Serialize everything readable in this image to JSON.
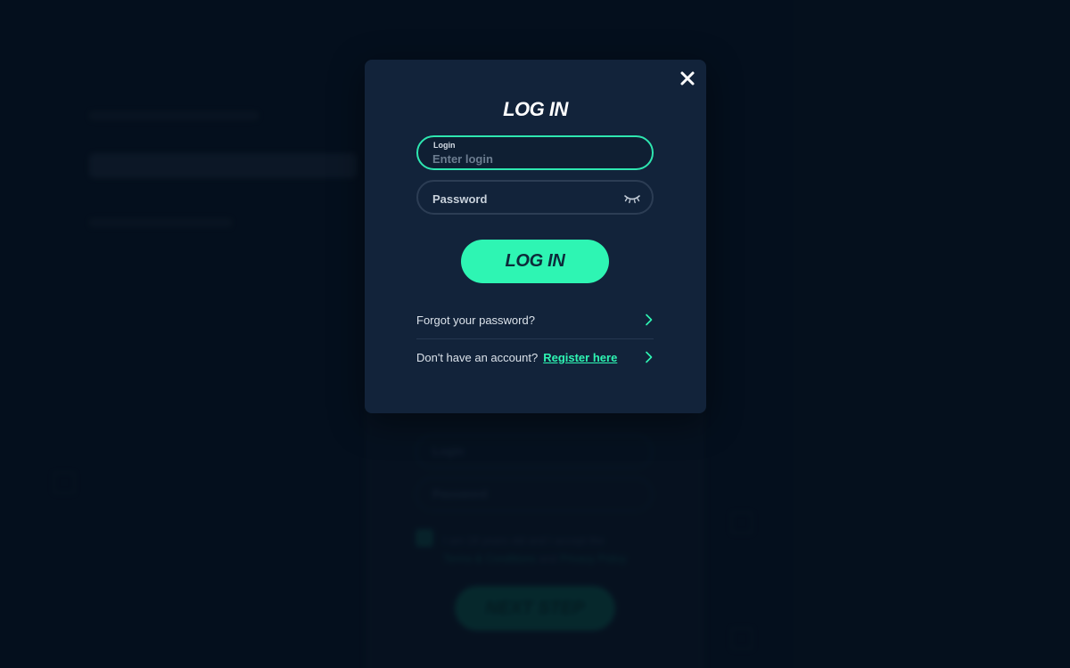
{
  "background": {
    "next_step_label": "NEXT STEP",
    "login_placeholder": "Login",
    "password_placeholder": "Password",
    "terms_prefix": "I am 18 years old and I accept the",
    "terms_link": "Terms & Conditions",
    "terms_and": "and",
    "privacy_link": "Privacy Policy"
  },
  "modal": {
    "title": "LOG IN",
    "login_label": "Login",
    "login_placeholder": "Enter login",
    "password_placeholder": "Password",
    "login_button": "LOG IN",
    "forgot_text": "Forgot your password?",
    "register_text": "Don't have an account?",
    "register_link": "Register here"
  },
  "colors": {
    "accent": "#2ef5b3",
    "modal_bg": "#12233a",
    "page_bg": "#061322"
  },
  "icons": {
    "close": "close-icon",
    "eye": "eye-closed-icon",
    "chevron": "chevron-right-icon"
  }
}
